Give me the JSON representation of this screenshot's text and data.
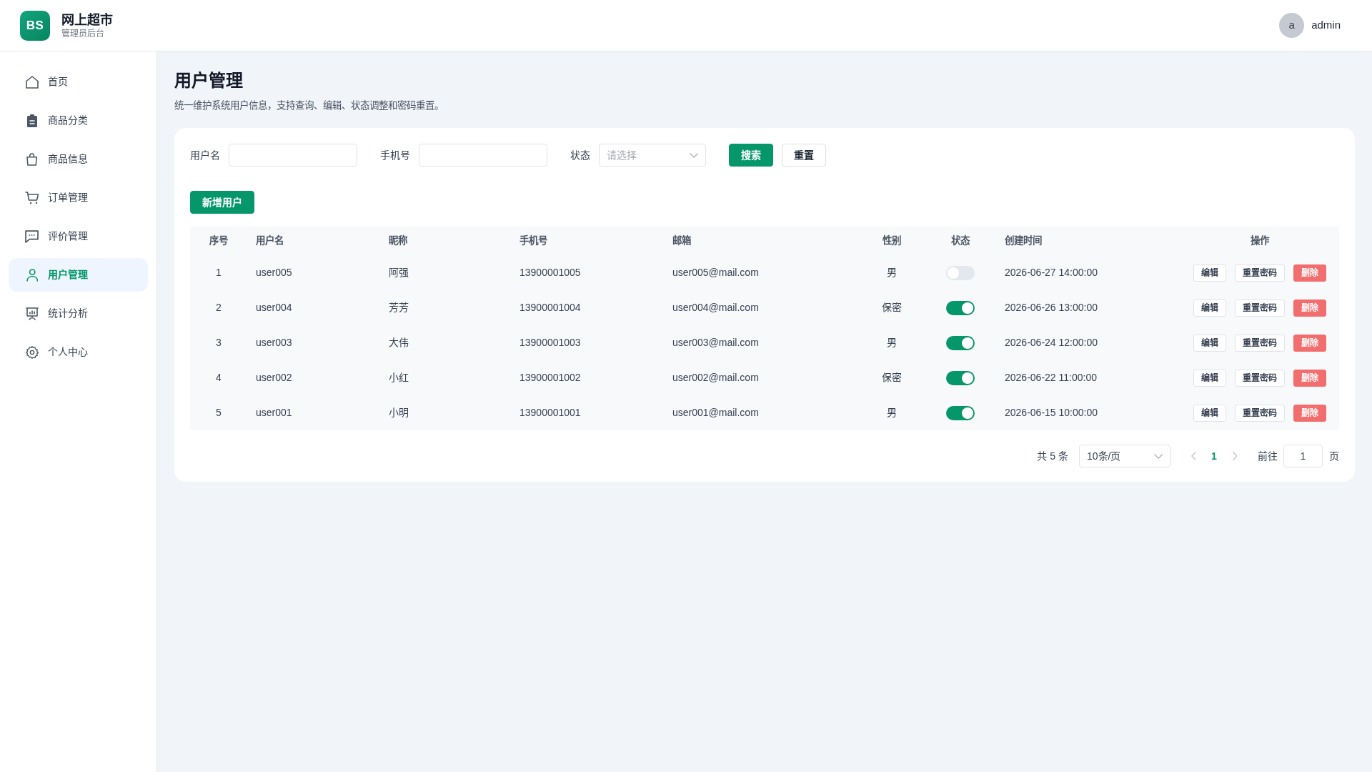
{
  "header": {
    "logo": "BS",
    "title": "网上超市",
    "subtitle": "管理员后台",
    "user": {
      "avatar": "a",
      "name": "admin"
    }
  },
  "sidebar": {
    "items": [
      {
        "label": "首页",
        "selected": false
      },
      {
        "label": "商品分类",
        "selected": false
      },
      {
        "label": "商品信息",
        "selected": false
      },
      {
        "label": "订单管理",
        "selected": false
      },
      {
        "label": "评价管理",
        "selected": false
      },
      {
        "label": "用户管理",
        "selected": true
      },
      {
        "label": "统计分析",
        "selected": false
      },
      {
        "label": "个人中心",
        "selected": false
      }
    ]
  },
  "page": {
    "title": "用户管理",
    "description": "统一维护系统用户信息，支持查询、编辑、状态调整和密码重置。"
  },
  "filters": {
    "fields": [
      {
        "kind": "text",
        "label": "用户名"
      },
      {
        "kind": "text",
        "label": "手机号"
      },
      {
        "kind": "select",
        "label": "状态",
        "placeholder": "请选择"
      }
    ],
    "buttons": [
      {
        "kind": "primary",
        "label": "搜索"
      },
      {
        "kind": "default",
        "label": "重置"
      }
    ]
  },
  "toolbar": {
    "buttons": [
      {
        "kind": "primary",
        "label": "新增用户"
      }
    ]
  },
  "table": {
    "columns": [
      "序号",
      "用户名",
      "昵称",
      "手机号",
      "邮箱",
      "性别",
      "状态",
      "创建时间",
      "操作"
    ],
    "rows": [
      {
        "index": "1",
        "username": "user005",
        "nickname": "阿强",
        "phone": "13900001005",
        "email": "user005@mail.com",
        "gender": "男",
        "enabled": false,
        "created_at": "2026-06-27 14:00:00",
        "actions": [
          {
            "kind": "default",
            "label": "编辑"
          },
          {
            "kind": "default",
            "label": "重置密码"
          },
          {
            "kind": "danger",
            "label": "删除"
          }
        ]
      },
      {
        "index": "2",
        "username": "user004",
        "nickname": "芳芳",
        "phone": "13900001004",
        "email": "user004@mail.com",
        "gender": "保密",
        "enabled": true,
        "created_at": "2026-06-26 13:00:00",
        "actions": [
          {
            "kind": "default",
            "label": "编辑"
          },
          {
            "kind": "default",
            "label": "重置密码"
          },
          {
            "kind": "danger",
            "label": "删除"
          }
        ]
      },
      {
        "index": "3",
        "username": "user003",
        "nickname": "大伟",
        "phone": "13900001003",
        "email": "user003@mail.com",
        "gender": "男",
        "enabled": true,
        "created_at": "2026-06-24 12:00:00",
        "actions": [
          {
            "kind": "default",
            "label": "编辑"
          },
          {
            "kind": "default",
            "label": "重置密码"
          },
          {
            "kind": "danger",
            "label": "删除"
          }
        ]
      },
      {
        "index": "4",
        "username": "user002",
        "nickname": "小红",
        "phone": "13900001002",
        "email": "user002@mail.com",
        "gender": "保密",
        "enabled": true,
        "created_at": "2026-06-22 11:00:00",
        "actions": [
          {
            "kind": "default",
            "label": "编辑"
          },
          {
            "kind": "default",
            "label": "重置密码"
          },
          {
            "kind": "danger",
            "label": "删除"
          }
        ]
      },
      {
        "index": "5",
        "username": "user001",
        "nickname": "小明",
        "phone": "13900001001",
        "email": "user001@mail.com",
        "gender": "男",
        "enabled": true,
        "created_at": "2026-06-15 10:00:00",
        "actions": [
          {
            "kind": "default",
            "label": "编辑"
          },
          {
            "kind": "default",
            "label": "重置密码"
          },
          {
            "kind": "danger",
            "label": "删除"
          }
        ]
      }
    ]
  },
  "pagination": {
    "total": "共 5 条",
    "page_size": "10条/页",
    "prev": {
      "disabled": true
    },
    "pages": [
      {
        "label": "1",
        "selected": true
      }
    ],
    "next": {
      "disabled": true
    },
    "goto_label": "前往",
    "goto_value": "1",
    "goto_suffix": "页"
  }
}
